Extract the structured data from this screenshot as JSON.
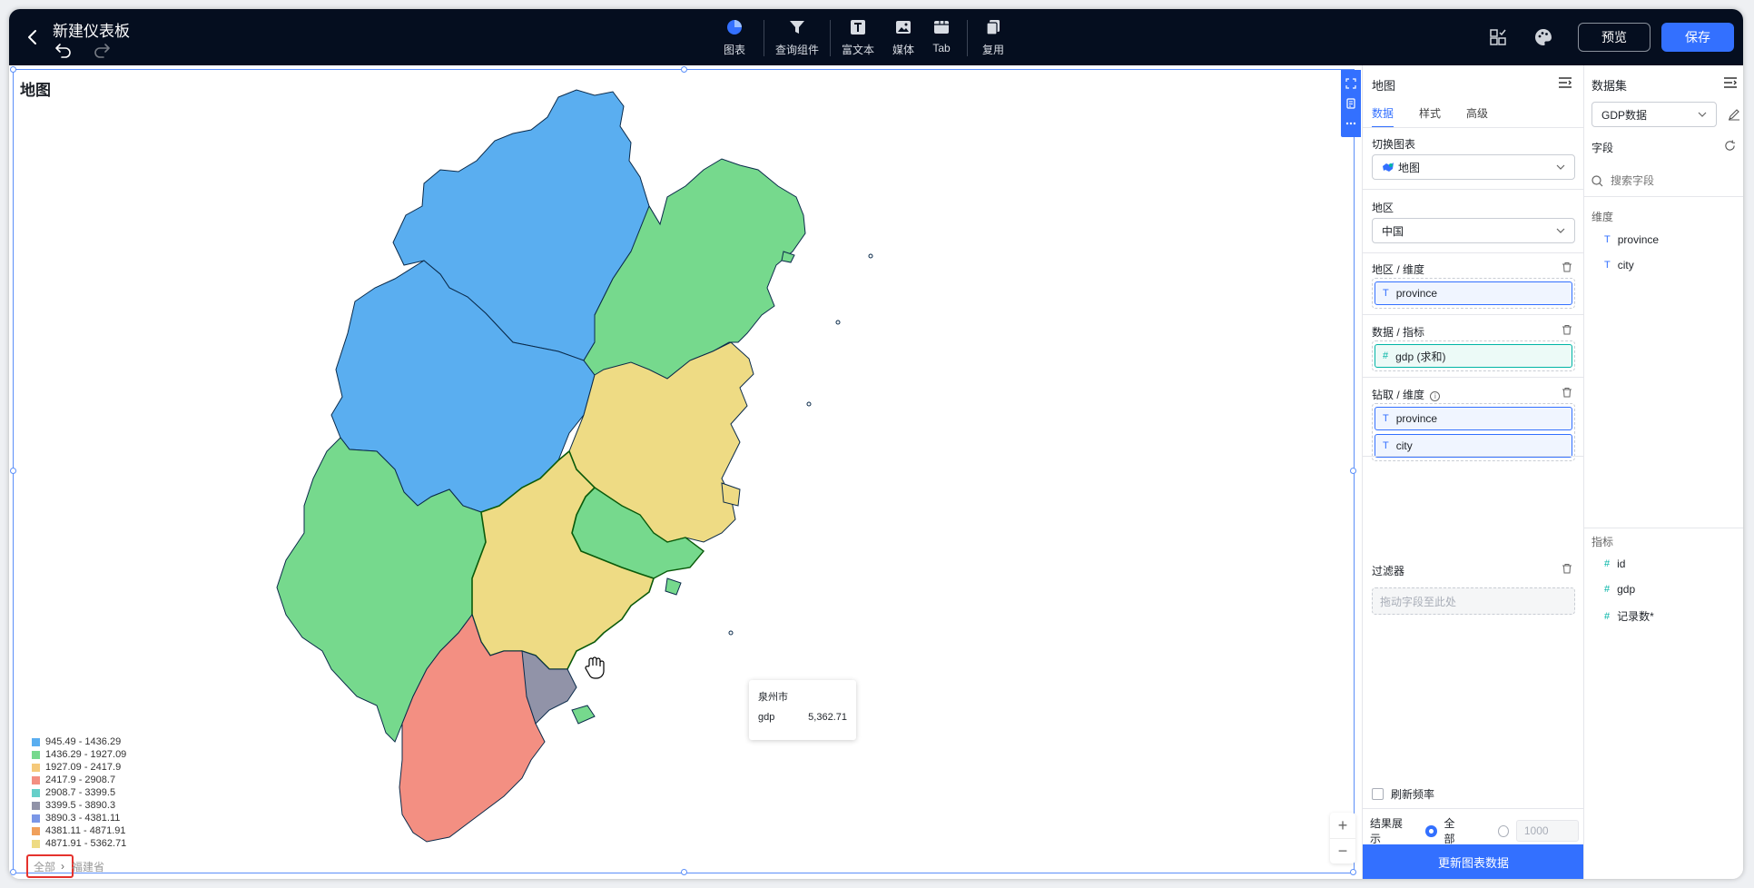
{
  "header": {
    "title": "新建仪表板",
    "tools": [
      {
        "label": "图表",
        "icon": "pie-chart-icon"
      },
      {
        "label": "查询组件",
        "icon": "filter-icon"
      },
      {
        "label": "富文本",
        "icon": "text-icon"
      },
      {
        "label": "媒体",
        "icon": "image-icon"
      },
      {
        "label": "Tab",
        "icon": "tab-icon"
      },
      {
        "label": "复用",
        "icon": "copy-icon"
      }
    ],
    "preview_label": "预览",
    "save_label": "保存",
    "accent_color": "#3370ff"
  },
  "chart": {
    "title": "地图",
    "legend": [
      {
        "label": "945.49 - 1436.29",
        "color": "#5aaef0"
      },
      {
        "label": "1436.29 - 1927.09",
        "color": "#76d98d"
      },
      {
        "label": "1927.09 - 2417.9",
        "color": "#f5c97a"
      },
      {
        "label": "2417.9 - 2908.7",
        "color": "#f38f82"
      },
      {
        "label": "2908.7 - 3399.5",
        "color": "#66cfc9"
      },
      {
        "label": "3399.5 - 3890.3",
        "color": "#9193a8"
      },
      {
        "label": "3890.3 - 4381.11",
        "color": "#7b97e6"
      },
      {
        "label": "4381.11 - 4871.91",
        "color": "#f0a05b"
      },
      {
        "label": "4871.91 - 5362.71",
        "color": "#eedb84"
      }
    ],
    "tooltip": {
      "city": "泉州市",
      "metric": "gdp",
      "value": "5,362.71"
    },
    "zoom_in": "+",
    "zoom_out": "−",
    "breadcrumb": {
      "root": "全部",
      "current": "福建省"
    }
  },
  "props": {
    "title": "地图",
    "tabs": [
      "数据",
      "样式",
      "高级"
    ],
    "switch_chart_label": "切换图表",
    "chart_type": "地图",
    "region_label": "地区",
    "region_value": "中国",
    "region_dim_label": "地区 / 维度",
    "region_dim_field": "province",
    "metric_label": "数据 / 指标",
    "metric_field": "gdp (求和)",
    "drill_label": "钻取 / 维度",
    "drill_fields": [
      "province",
      "city"
    ],
    "filter_label": "过滤器",
    "filter_placeholder": "拖动字段至此处",
    "refresh_label": "刷新频率",
    "result_label": "结果展示",
    "result_all": "全部",
    "result_limit": "1000",
    "update_button": "更新图表数据"
  },
  "dataset": {
    "title": "数据集",
    "selected": "GDP数据",
    "fields_label": "字段",
    "search_placeholder": "搜索字段",
    "dim_label": "维度",
    "dimensions": [
      "province",
      "city"
    ],
    "measure_label": "指标",
    "measures": [
      "id",
      "gdp",
      "记录数*"
    ]
  }
}
